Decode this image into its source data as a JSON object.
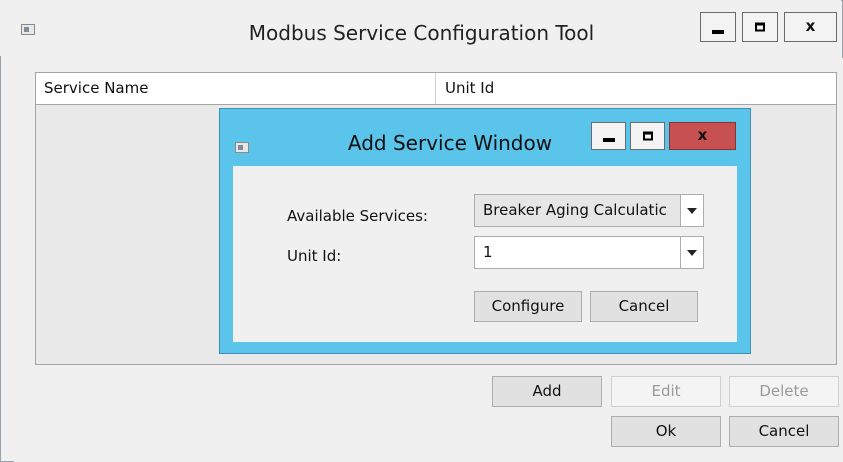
{
  "main_window": {
    "title": "Modbus Service Configuration Tool",
    "controls": {
      "minimize": "",
      "maximize": "",
      "close": "x"
    }
  },
  "list": {
    "columns": [
      "Service Name",
      "Unit Id"
    ],
    "rows": []
  },
  "buttons": {
    "add": "Add",
    "edit": "Edit",
    "delete": "Delete",
    "ok": "Ok",
    "cancel": "Cancel"
  },
  "dialog": {
    "title": "Add Service Window",
    "controls": {
      "close": "x"
    },
    "available_services_label": "Available Services:",
    "available_services_value": "Breaker Aging Calculatic",
    "unit_id_label": "Unit Id:",
    "unit_id_value": "1",
    "configure_label": "Configure",
    "cancel_label": "Cancel",
    "titlebar_color": "#5bc4ea",
    "close_color": "#c75050"
  }
}
